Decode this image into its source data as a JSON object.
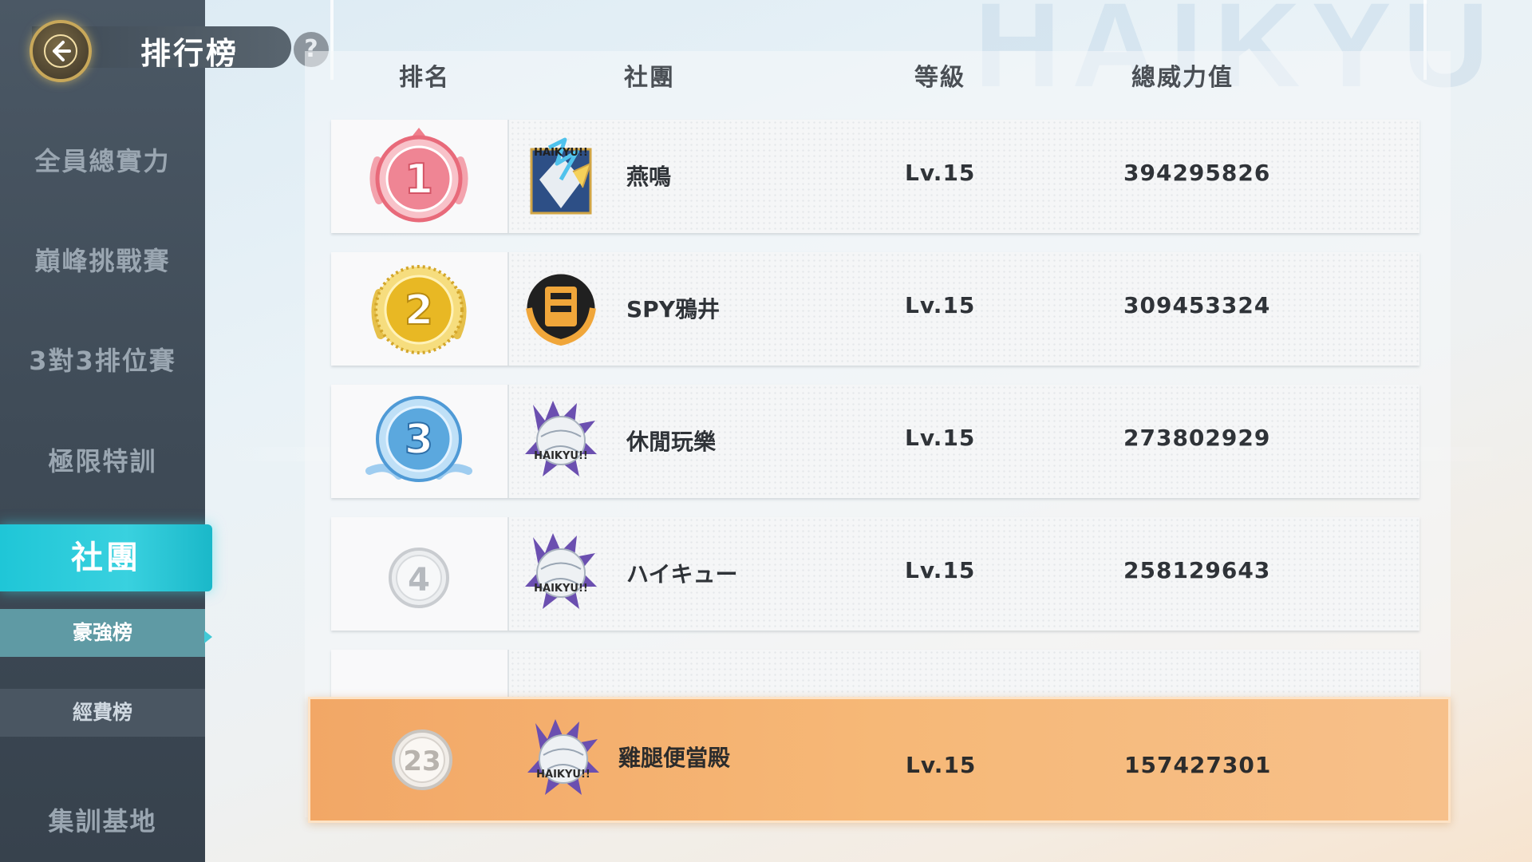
{
  "header": {
    "title": "排行榜",
    "help": "?"
  },
  "background": {
    "watermark": "HAIKYU"
  },
  "sidebar": {
    "items": [
      "全員總實力",
      "巔峰挑戰賽",
      "3對3排位賽",
      "極限特訓"
    ],
    "active": "社團",
    "sub_items": [
      "豪強榜",
      "經費榜"
    ],
    "bottom": "集訓基地"
  },
  "table": {
    "columns": [
      "排名",
      "社團",
      "等級",
      "總威力值"
    ],
    "rows": [
      {
        "rank": "1",
        "name": "燕鳴",
        "level": "Lv.15",
        "power": "394295826"
      },
      {
        "rank": "2",
        "name": "SPY鴉井",
        "level": "Lv.15",
        "power": "309453324"
      },
      {
        "rank": "3",
        "name": "休閒玩樂",
        "level": "Lv.15",
        "power": "273802929"
      },
      {
        "rank": "4",
        "name": "ハイキュー",
        "level": "Lv.15",
        "power": "258129643"
      }
    ],
    "self": {
      "rank": "23",
      "name": "雞腿便當殿",
      "level": "Lv.15",
      "power": "157427301"
    }
  },
  "logo_text": "HAIKYU!!",
  "colors": {
    "gold_medal": "#e8b824",
    "pink_medal": "#ef7f8c",
    "blue_medal": "#5ba8de",
    "silver_medal": "#c9ccd0",
    "sidebar_active": "#2cc9d9",
    "self_row": "#f4b170"
  }
}
